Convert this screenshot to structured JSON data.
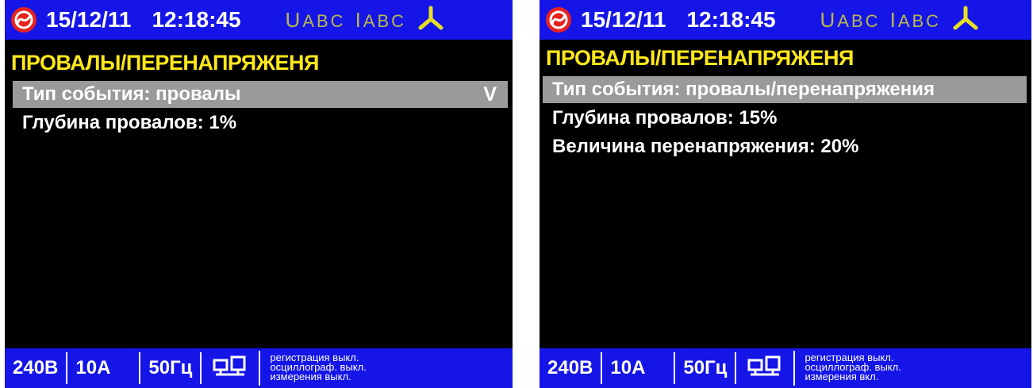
{
  "colors": {
    "bar": "#1515e8",
    "title": "#ffe81a",
    "selected_row": "#9a9a9a",
    "indicator": "#b8b84a",
    "logo": "#e8231e"
  },
  "screens": [
    {
      "topbar": {
        "logo_icon": "meter-logo-icon",
        "date": "15/12/11",
        "time": "12:18:45",
        "u_letter": "U",
        "u_sub": "ABC",
        "i_letter": "I",
        "i_sub": "ABC",
        "phase_icon": "three-phase-icon"
      },
      "title": "ПРОВАЛЫ/ПЕРЕНАПРЯЖЕНЯ",
      "rows": [
        {
          "label": "Тип события: провалы",
          "selected": true,
          "chevron": "V"
        },
        {
          "label": "Глубина провалов: 1%",
          "selected": false
        }
      ],
      "bottombar": {
        "voltage": "240В",
        "current": "10А",
        "frequency": "50Гц",
        "network_icon": "network-computers-icon",
        "status": [
          "регистрация выкл.",
          "осциллограф. выкл.",
          "измерения выкл."
        ]
      }
    },
    {
      "topbar": {
        "logo_icon": "meter-logo-icon",
        "date": "15/12/11",
        "time": "12:18:45",
        "u_letter": "U",
        "u_sub": "ABC",
        "i_letter": "I",
        "i_sub": "ABC",
        "phase_icon": "three-phase-icon"
      },
      "title": "ПРОВАЛЫ/ПЕРЕНАПРЯЖЕНЯ",
      "rows": [
        {
          "label": "Тип события: провалы/перенапряжения",
          "selected": true
        },
        {
          "label": "Глубина провалов: 15%",
          "selected": false
        },
        {
          "label": "Величина перенапряжения: 20%",
          "selected": false
        }
      ],
      "bottombar": {
        "voltage": "240В",
        "current": "10А",
        "frequency": "50Гц",
        "network_icon": "network-computers-icon",
        "status": [
          "регистрация выкл.",
          "осциллограф. выкл.",
          "измерения вкл."
        ]
      }
    }
  ]
}
